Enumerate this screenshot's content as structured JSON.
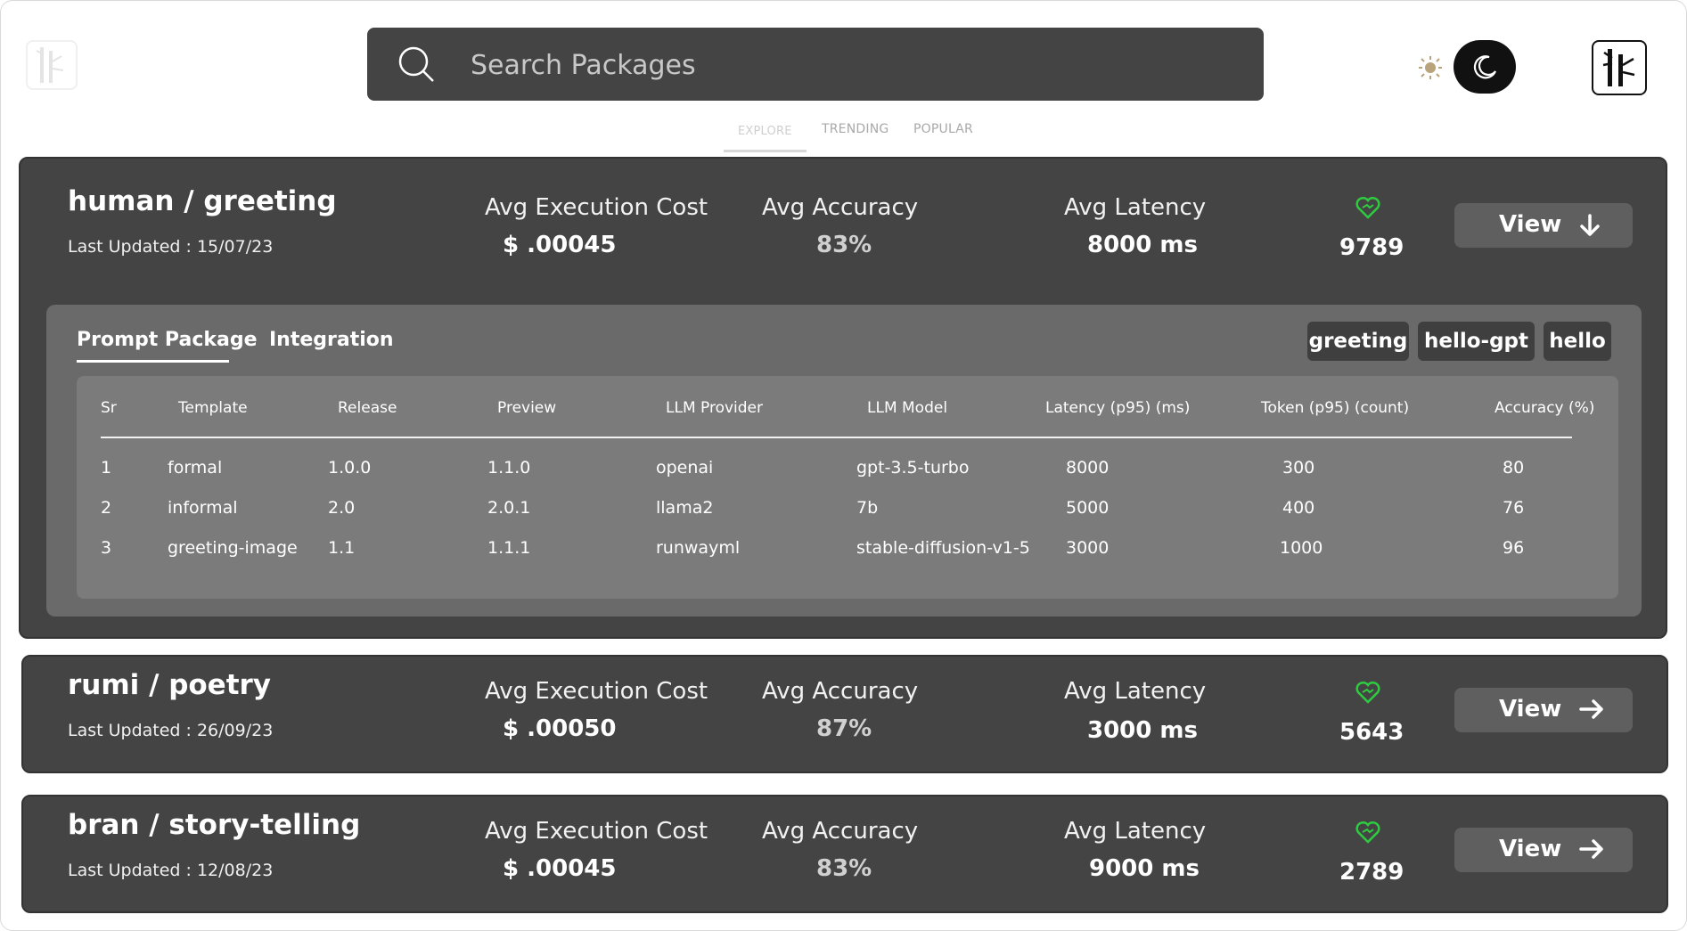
{
  "header": {
    "search_placeholder": "Search Packages",
    "nav_tabs": [
      {
        "label": "EXPLORE",
        "active": true
      },
      {
        "label": "TRENDING",
        "active": false
      },
      {
        "label": "POPULAR",
        "active": false
      }
    ],
    "theme": "dark"
  },
  "colors": {
    "card_bg": "#444444",
    "panel_bg": "#6a6a6a",
    "table_bg": "#7b7b7b",
    "heart": "#2ecc40",
    "view_button_bg": "#5f5f5f"
  },
  "cards": [
    {
      "name": "human / greeting",
      "last_updated": "Last Updated : 15/07/23",
      "cost_label": "Avg Execution Cost",
      "cost": "$ .00045",
      "accuracy_label": "Avg Accuracy",
      "accuracy": "83%",
      "latency_label": "Avg Latency",
      "latency": "8000 ms",
      "likes": "9789",
      "view_label": "View",
      "arrow": "arrow-down-icon",
      "expanded": true
    },
    {
      "name": "rumi / poetry",
      "last_updated": "Last Updated : 26/09/23",
      "cost_label": "Avg Execution Cost",
      "cost": "$ .00050",
      "accuracy_label": "Avg Accuracy",
      "accuracy": "87%",
      "latency_label": "Avg Latency",
      "latency": "3000 ms",
      "likes": "5643",
      "view_label": "View",
      "arrow": "arrow-right-icon",
      "expanded": false
    },
    {
      "name": "bran / story-telling",
      "last_updated": "Last Updated : 12/08/23",
      "cost_label": "Avg Execution Cost",
      "cost": "$ .00045",
      "accuracy_label": "Avg Accuracy",
      "accuracy": "83%",
      "latency_label": "Avg Latency",
      "latency": "9000 ms",
      "likes": "2789",
      "view_label": "View",
      "arrow": "arrow-right-icon",
      "expanded": false
    }
  ],
  "detail": {
    "tabs": [
      "Prompt Package",
      "Integration"
    ],
    "active_tab": "Prompt Package",
    "tags": [
      "greeting",
      "hello-gpt",
      "hello"
    ],
    "columns": [
      "Sr",
      "Template",
      "Release",
      "Preview",
      "LLM Provider",
      "LLM Model",
      "Latency (p95) (ms)",
      "Token (p95) (count)",
      "Accuracy (%)"
    ],
    "rows": [
      [
        "1",
        "formal",
        "1.0.0",
        "1.1.0",
        "openai",
        "gpt-3.5-turbo",
        "8000",
        "300",
        "80"
      ],
      [
        "2",
        "informal",
        "2.0",
        "2.0.1",
        "llama2",
        "7b",
        "5000",
        "400",
        "76"
      ],
      [
        "3",
        "greeting-image",
        "1.1",
        "1.1.1",
        "runwayml",
        "stable-diffusion-v1-5",
        "3000",
        "1000",
        "96"
      ]
    ]
  }
}
